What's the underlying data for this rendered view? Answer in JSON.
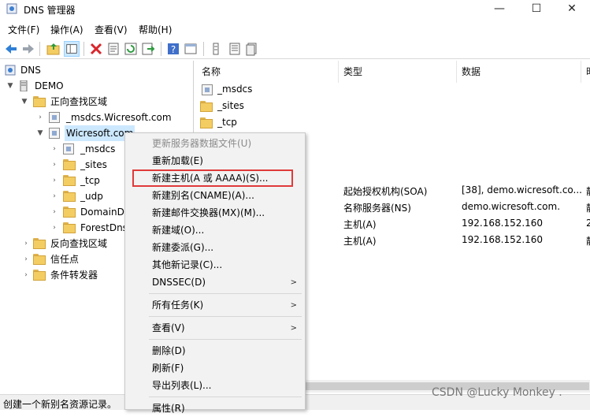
{
  "window": {
    "title": "DNS 管理器",
    "controls": {
      "minimize": "—",
      "maximize": "☐",
      "close": "✕"
    }
  },
  "menubar": [
    "文件(F)",
    "操作(A)",
    "查看(V)",
    "帮助(H)"
  ],
  "toolbar": [
    "back-icon",
    "forward-icon",
    "up-folder-icon",
    "show-tree-icon",
    "delete-icon",
    "properties-icon",
    "refresh-icon",
    "export-icon",
    "help-icon",
    "console-icon",
    "list-icon",
    "detail-icon",
    "filter-icon"
  ],
  "tree": {
    "root": "DNS",
    "server": "DEMO",
    "forward_zones": "正向查找区域",
    "msdcs_zone": "_msdcs.Wicresoft.com",
    "zone": "Wicresoft.com",
    "zone_children": [
      "_msdcs",
      "_sites",
      "_tcp",
      "_udp",
      "DomainDnsZones",
      "ForestDnsZones"
    ],
    "reverse_zones": "反向查找区域",
    "trust_points": "信任点",
    "conditional_forwarders": "条件转发器"
  },
  "list": {
    "columns": [
      "名称",
      "类型",
      "数据",
      "时"
    ],
    "rows": [
      {
        "name": "_msdcs",
        "type": "",
        "data": "",
        "ts": ""
      },
      {
        "name": "_sites",
        "type": "",
        "data": "",
        "ts": ""
      },
      {
        "name": "_tcp",
        "type": "",
        "data": "",
        "ts": ""
      },
      {
        "name": "",
        "type": "起始授权机构(SOA)",
        "data": "[38], demo.wicresoft.co...",
        "ts": "静"
      },
      {
        "name": "",
        "type": "名称服务器(NS)",
        "data": "demo.wicresoft.com.",
        "ts": "静"
      },
      {
        "name": "",
        "type": "主机(A)",
        "data": "192.168.152.160",
        "ts": "2"
      },
      {
        "name": "",
        "type": "主机(A)",
        "data": "192.168.152.160",
        "ts": "静"
      }
    ]
  },
  "context_menu": {
    "items": [
      {
        "label": "更新服务器数据文件(U)",
        "disabled": true
      },
      {
        "label": "重新加载(E)"
      },
      {
        "label": "新建主机(A 或 AAAA)(S)...",
        "highlighted": true
      },
      {
        "label": "新建别名(CNAME)(A)..."
      },
      {
        "label": "新建邮件交换器(MX)(M)..."
      },
      {
        "label": "新建域(O)..."
      },
      {
        "label": "新建委派(G)..."
      },
      {
        "label": "其他新记录(C)..."
      },
      {
        "label": "DNSSEC(D)",
        "submenu": true
      },
      {
        "label": "所有任务(K)",
        "submenu": true
      },
      {
        "label": "查看(V)",
        "submenu": true
      },
      {
        "label": "删除(D)"
      },
      {
        "label": "刷新(F)"
      },
      {
        "label": "导出列表(L)..."
      },
      {
        "label": "属性(R)"
      }
    ]
  },
  "status": "创建一个新别名资源记录。",
  "watermark": "CSDN @Lucky Monkey ."
}
